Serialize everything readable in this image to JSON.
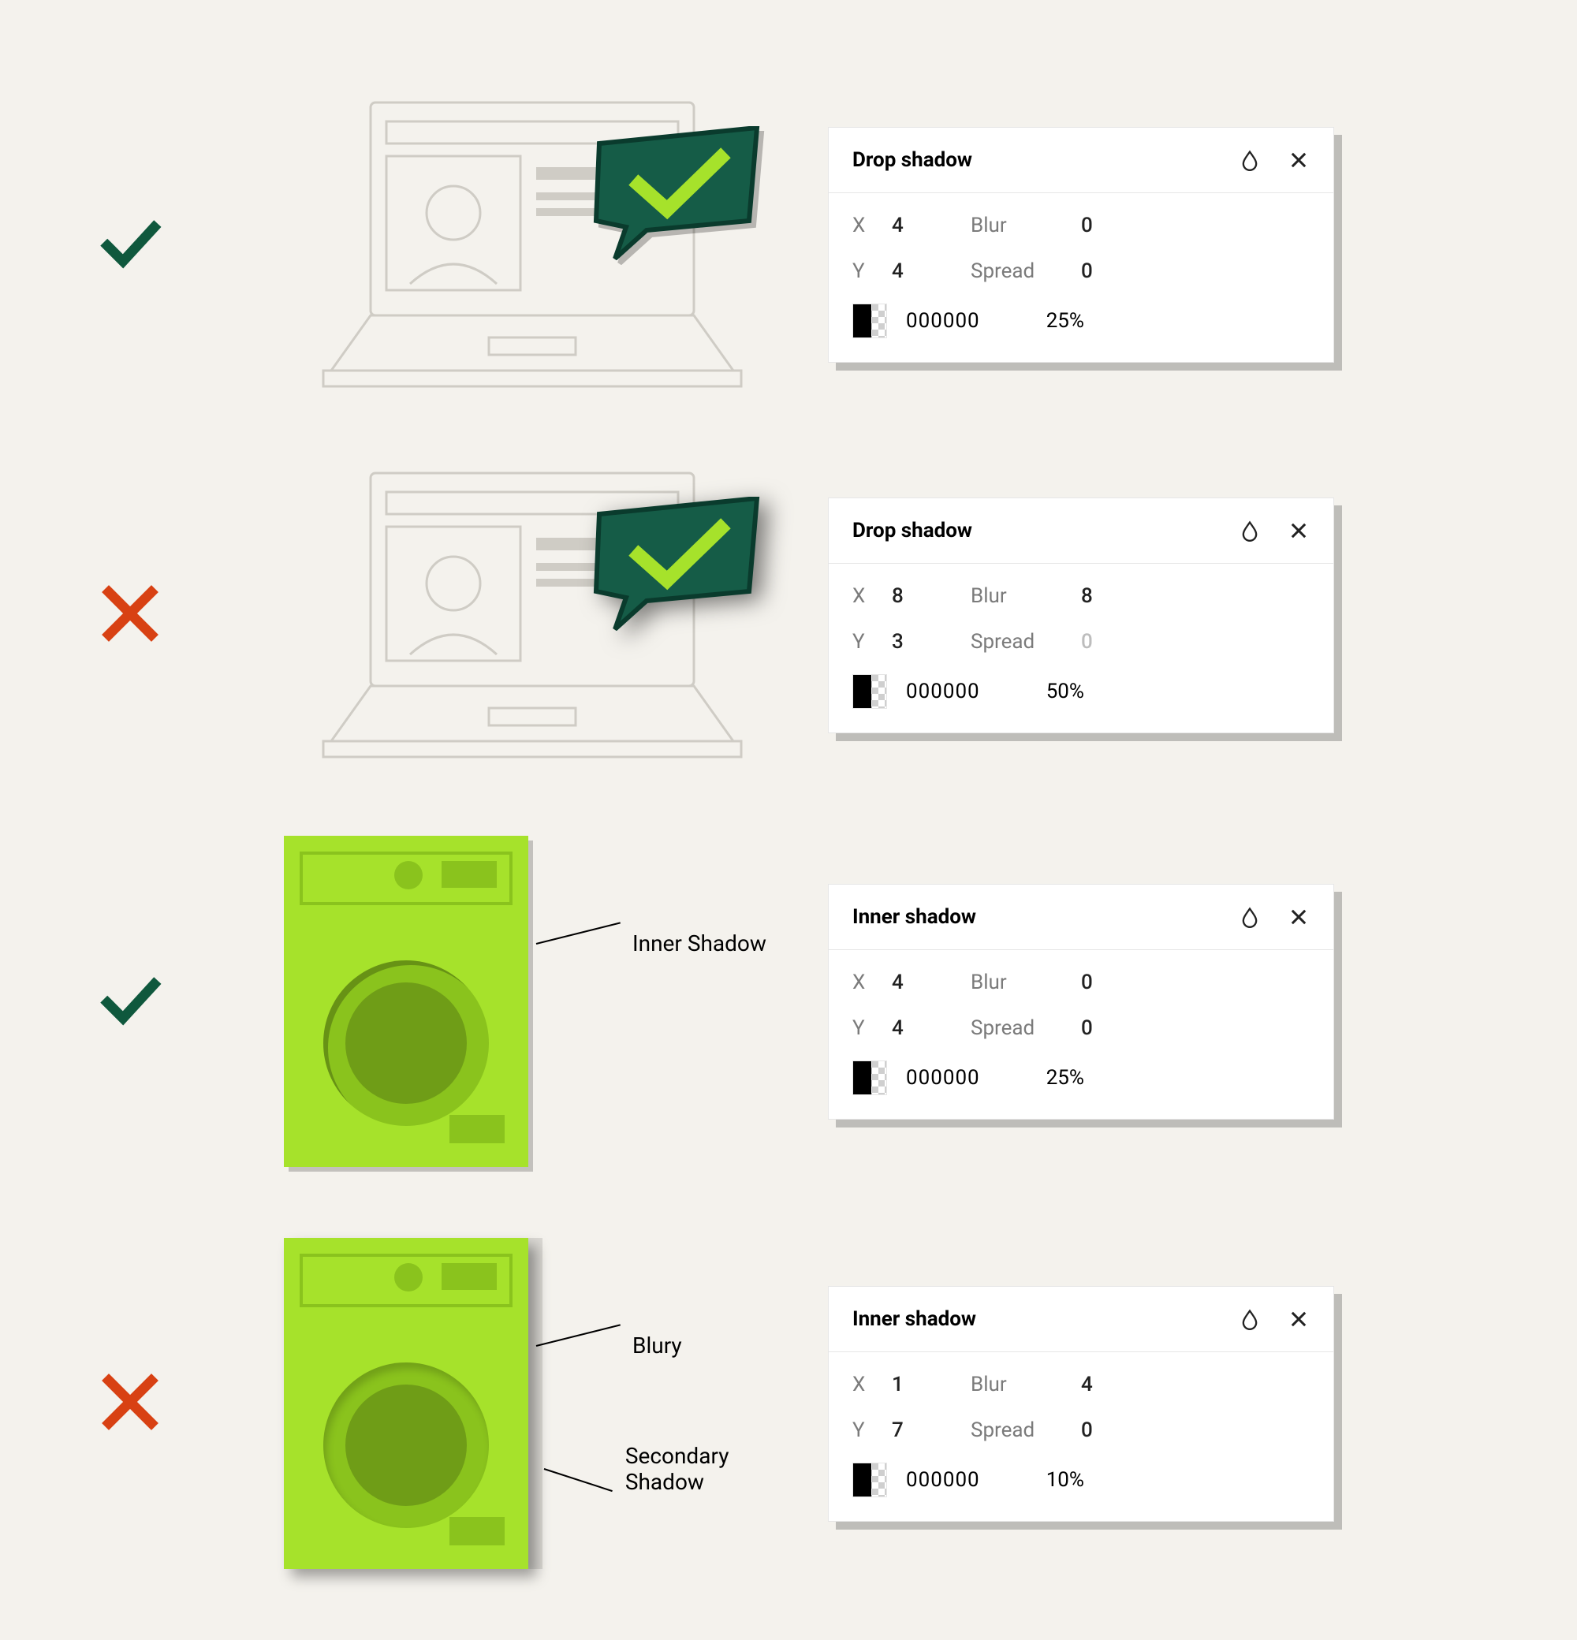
{
  "rows": [
    {
      "status": "good",
      "panel": {
        "title": "Drop shadow",
        "x": "4",
        "y": "4",
        "blur": "0",
        "spread": "0",
        "spread_disabled": false,
        "hex": "000000",
        "opacity": "25%"
      }
    },
    {
      "status": "bad",
      "panel": {
        "title": "Drop shadow",
        "x": "8",
        "y": "3",
        "blur": "8",
        "spread": "0",
        "spread_disabled": true,
        "hex": "000000",
        "opacity": "50%"
      }
    },
    {
      "status": "good",
      "callouts": {
        "a": "Inner Shadow"
      },
      "panel": {
        "title": "Inner shadow",
        "x": "4",
        "y": "4",
        "blur": "0",
        "spread": "0",
        "spread_disabled": false,
        "hex": "000000",
        "opacity": "25%"
      }
    },
    {
      "status": "bad",
      "callouts": {
        "a": "Blury",
        "b": "Secondary Shadow"
      },
      "panel": {
        "title": "Inner shadow",
        "x": "1",
        "y": "7",
        "blur": "4",
        "spread": "0",
        "spread_disabled": false,
        "hex": "000000",
        "opacity": "10%"
      }
    }
  ],
  "labels": {
    "x": "X",
    "y": "Y",
    "blur": "Blur",
    "spread": "Spread"
  }
}
